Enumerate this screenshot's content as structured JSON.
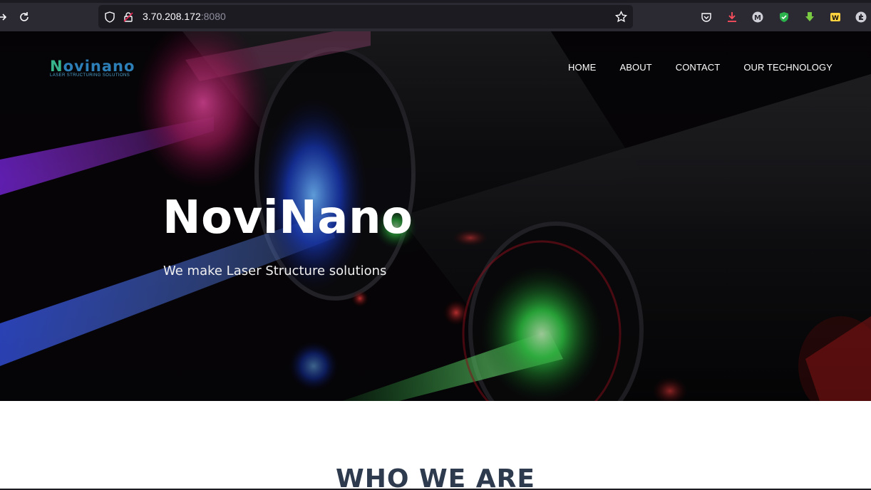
{
  "browser": {
    "url_host": "3.70.208.172",
    "url_port": ":8080"
  },
  "site": {
    "logo_word_prefix": "N",
    "logo_word_rest": "ovinano",
    "logo_tagline": "LASER STRUCTURING SOLUTIONS",
    "nav": [
      "HOME",
      "ABOUT",
      "CONTACT",
      "OUR TECHNOLOGY"
    ]
  },
  "hero": {
    "title": "NoviNano",
    "subtitle": "We make Laser Structure solutions"
  },
  "section": {
    "heading": "WHO WE ARE"
  },
  "colors": {
    "chrome_bg": "#2b2a33",
    "urlbar_bg": "#1c1b22",
    "heading_color": "#2e3b4e",
    "logo_blue": "#2d7fb8",
    "logo_green": "#38b48b"
  }
}
